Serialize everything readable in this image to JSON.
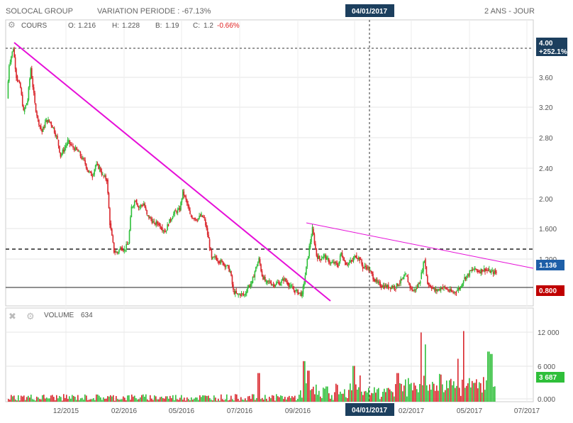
{
  "header": {
    "instrument": "SOLOCAL GROUP",
    "variation_label": "VARIATION PERIODE : -67.13%",
    "crosshair_date": "04/01/2017",
    "period_label": "2 ANS - JOUR"
  },
  "price_panel": {
    "series_label": "COURS",
    "ohlc": {
      "open_label": "O:",
      "open": "1.216",
      "high_label": "H:",
      "high": "1.228",
      "low_label": "B:",
      "low": "1.19",
      "close_label": "C:",
      "close": "1.2",
      "change": "-0.66%"
    },
    "badges": {
      "cursor_value": "4.00",
      "cursor_pct": "+252.1%",
      "last_price": "1.136",
      "support": "0.800"
    }
  },
  "volume_panel": {
    "series_label": "VOLUME",
    "series_value": "634",
    "last_volume": "3 687"
  },
  "colors": {
    "up": "#2fbf3a",
    "down": "#d9252b",
    "trendline": "#e60fd8",
    "axis_badge_blue": "#1e5fa8",
    "axis_badge_red": "#c00000",
    "crosshair_badge": "#1c3f5e",
    "change_negative": "#e02020"
  },
  "chart_data": [
    {
      "type": "candlestick",
      "title": "",
      "x_tick_labels": [
        "12/2015",
        "02/2016",
        "05/2016",
        "07/2016",
        "09/2016",
        "04/01/2017",
        "02/2017",
        "05/2017",
        "07/2017"
      ],
      "y_ticks": [
        "3.60",
        "3.20",
        "2.80",
        "2.40",
        "2.00",
        "1.600",
        "1.200"
      ],
      "ylim": [
        0.74,
        4.2
      ],
      "close_path": [
        [
          "2015-10-20",
          3.32
        ],
        [
          "2015-10-22",
          3.75
        ],
        [
          "2015-10-26",
          3.95
        ],
        [
          "2015-10-29",
          3.6
        ],
        [
          "2015-11-02",
          3.45
        ],
        [
          "2015-11-05",
          3.15
        ],
        [
          "2015-11-09",
          3.3
        ],
        [
          "2015-11-12",
          3.7
        ],
        [
          "2015-11-16",
          3.25
        ],
        [
          "2015-11-19",
          3.05
        ],
        [
          "2015-11-23",
          2.9
        ],
        [
          "2015-11-27",
          3.05
        ],
        [
          "2015-12-01",
          3.02
        ],
        [
          "2015-12-04",
          2.95
        ],
        [
          "2015-12-08",
          2.8
        ],
        [
          "2015-12-11",
          2.6
        ],
        [
          "2015-12-15",
          2.7
        ],
        [
          "2015-12-18",
          2.78
        ],
        [
          "2015-12-22",
          2.72
        ],
        [
          "2015-12-28",
          2.65
        ],
        [
          "2016-01-04",
          2.5
        ],
        [
          "2016-01-07",
          2.4
        ],
        [
          "2016-01-11",
          2.35
        ],
        [
          "2016-01-14",
          2.48
        ],
        [
          "2016-01-18",
          2.45
        ],
        [
          "2016-01-21",
          2.35
        ],
        [
          "2016-01-25",
          2.3
        ],
        [
          "2016-01-28",
          1.75
        ],
        [
          "2016-02-01",
          1.4
        ],
        [
          "2016-02-04",
          1.38
        ],
        [
          "2016-02-08",
          1.45
        ],
        [
          "2016-02-11",
          1.42
        ],
        [
          "2016-02-15",
          1.5
        ],
        [
          "2016-02-18",
          1.95
        ],
        [
          "2016-02-22",
          2.05
        ],
        [
          "2016-02-25",
          1.95
        ],
        [
          "2016-03-01",
          2.0
        ],
        [
          "2016-03-04",
          1.85
        ],
        [
          "2016-03-08",
          1.8
        ],
        [
          "2016-03-11",
          1.75
        ],
        [
          "2016-03-15",
          1.75
        ],
        [
          "2016-03-18",
          1.7
        ],
        [
          "2016-03-22",
          1.65
        ],
        [
          "2016-03-25",
          1.75
        ],
        [
          "2016-03-29",
          1.85
        ],
        [
          "2016-04-01",
          1.9
        ],
        [
          "2016-04-05",
          1.92
        ],
        [
          "2016-04-08",
          2.15
        ],
        [
          "2016-04-12",
          2.0
        ],
        [
          "2016-04-15",
          1.85
        ],
        [
          "2016-04-19",
          1.82
        ],
        [
          "2016-04-22",
          1.8
        ],
        [
          "2016-04-26",
          1.85
        ],
        [
          "2016-04-29",
          1.8
        ],
        [
          "2016-05-03",
          1.55
        ],
        [
          "2016-05-06",
          1.3
        ],
        [
          "2016-05-10",
          1.32
        ],
        [
          "2016-05-13",
          1.28
        ],
        [
          "2016-05-17",
          1.25
        ],
        [
          "2016-05-20",
          1.22
        ],
        [
          "2016-05-24",
          1.15
        ],
        [
          "2016-05-27",
          0.9
        ],
        [
          "2016-05-31",
          0.85
        ],
        [
          "2016-06-03",
          0.86
        ],
        [
          "2016-06-07",
          0.85
        ],
        [
          "2016-06-10",
          0.95
        ],
        [
          "2016-06-14",
          1.0
        ],
        [
          "2016-06-17",
          1.15
        ],
        [
          "2016-06-21",
          1.3
        ],
        [
          "2016-06-24",
          1.1
        ],
        [
          "2016-06-28",
          1.0
        ],
        [
          "2016-07-01",
          1.02
        ],
        [
          "2016-07-05",
          0.98
        ],
        [
          "2016-07-08",
          1.0
        ],
        [
          "2016-07-12",
          1.0
        ],
        [
          "2016-07-15",
          1.05
        ],
        [
          "2016-07-19",
          1.0
        ],
        [
          "2016-07-22",
          0.95
        ],
        [
          "2016-07-26",
          0.9
        ],
        [
          "2016-07-29",
          0.88
        ],
        [
          "2016-08-02",
          0.86
        ],
        [
          "2016-08-05",
          1.1
        ],
        [
          "2016-08-09",
          1.45
        ],
        [
          "2016-08-12",
          1.68
        ],
        [
          "2016-08-16",
          1.35
        ],
        [
          "2016-08-19",
          1.3
        ],
        [
          "2016-08-23",
          1.35
        ],
        [
          "2016-08-26",
          1.3
        ],
        [
          "2016-08-30",
          1.25
        ],
        [
          "2016-09-02",
          1.25
        ],
        [
          "2016-09-06",
          1.22
        ],
        [
          "2016-09-09",
          1.38
        ],
        [
          "2016-09-13",
          1.25
        ],
        [
          "2016-09-16",
          1.25
        ],
        [
          "2016-09-20",
          1.28
        ],
        [
          "2016-09-23",
          1.35
        ],
        [
          "2016-09-27",
          1.3
        ],
        [
          "2016-09-30",
          1.2
        ],
        [
          "2016-10-04",
          1.2
        ],
        [
          "2016-10-07",
          1.15
        ],
        [
          "2016-10-11",
          1.05
        ],
        [
          "2016-10-14",
          1.0
        ],
        [
          "2016-10-18",
          0.97
        ],
        [
          "2016-10-21",
          0.96
        ],
        [
          "2016-10-25",
          0.95
        ],
        [
          "2016-10-28",
          0.96
        ],
        [
          "2016-11-01",
          0.95
        ],
        [
          "2016-11-04",
          1.0
        ],
        [
          "2016-11-08",
          1.05
        ],
        [
          "2016-11-11",
          1.1
        ],
        [
          "2016-11-15",
          0.95
        ],
        [
          "2016-11-18",
          0.9
        ],
        [
          "2016-11-22",
          0.95
        ],
        [
          "2016-11-25",
          1.05
        ],
        [
          "2016-11-29",
          1.3
        ],
        [
          "2016-12-02",
          1.0
        ],
        [
          "2016-12-06",
          0.95
        ],
        [
          "2016-12-09",
          0.9
        ],
        [
          "2016-12-13",
          0.92
        ],
        [
          "2016-12-16",
          0.95
        ],
        [
          "2016-12-20",
          0.93
        ],
        [
          "2016-12-23",
          0.9
        ],
        [
          "2016-12-27",
          0.88
        ],
        [
          "2016-12-30",
          0.9
        ],
        [
          "2017-01-03",
          0.95
        ],
        [
          "2017-01-06",
          1.05
        ],
        [
          "2017-01-10",
          1.1
        ],
        [
          "2017-01-13",
          1.15
        ],
        [
          "2017-01-17",
          1.18
        ],
        [
          "2017-01-20",
          1.15
        ],
        [
          "2017-01-24",
          1.16
        ],
        [
          "2017-01-27",
          1.17
        ],
        [
          "2017-01-31",
          1.15
        ],
        [
          "2017-02-03",
          1.14
        ],
        [
          "2017-02-07",
          1.13
        ]
      ]
    },
    {
      "type": "bar",
      "title": "",
      "y_ticks": [
        "12 000",
        "6 000",
        "0.000"
      ],
      "ylim": [
        0,
        16500
      ]
    }
  ]
}
